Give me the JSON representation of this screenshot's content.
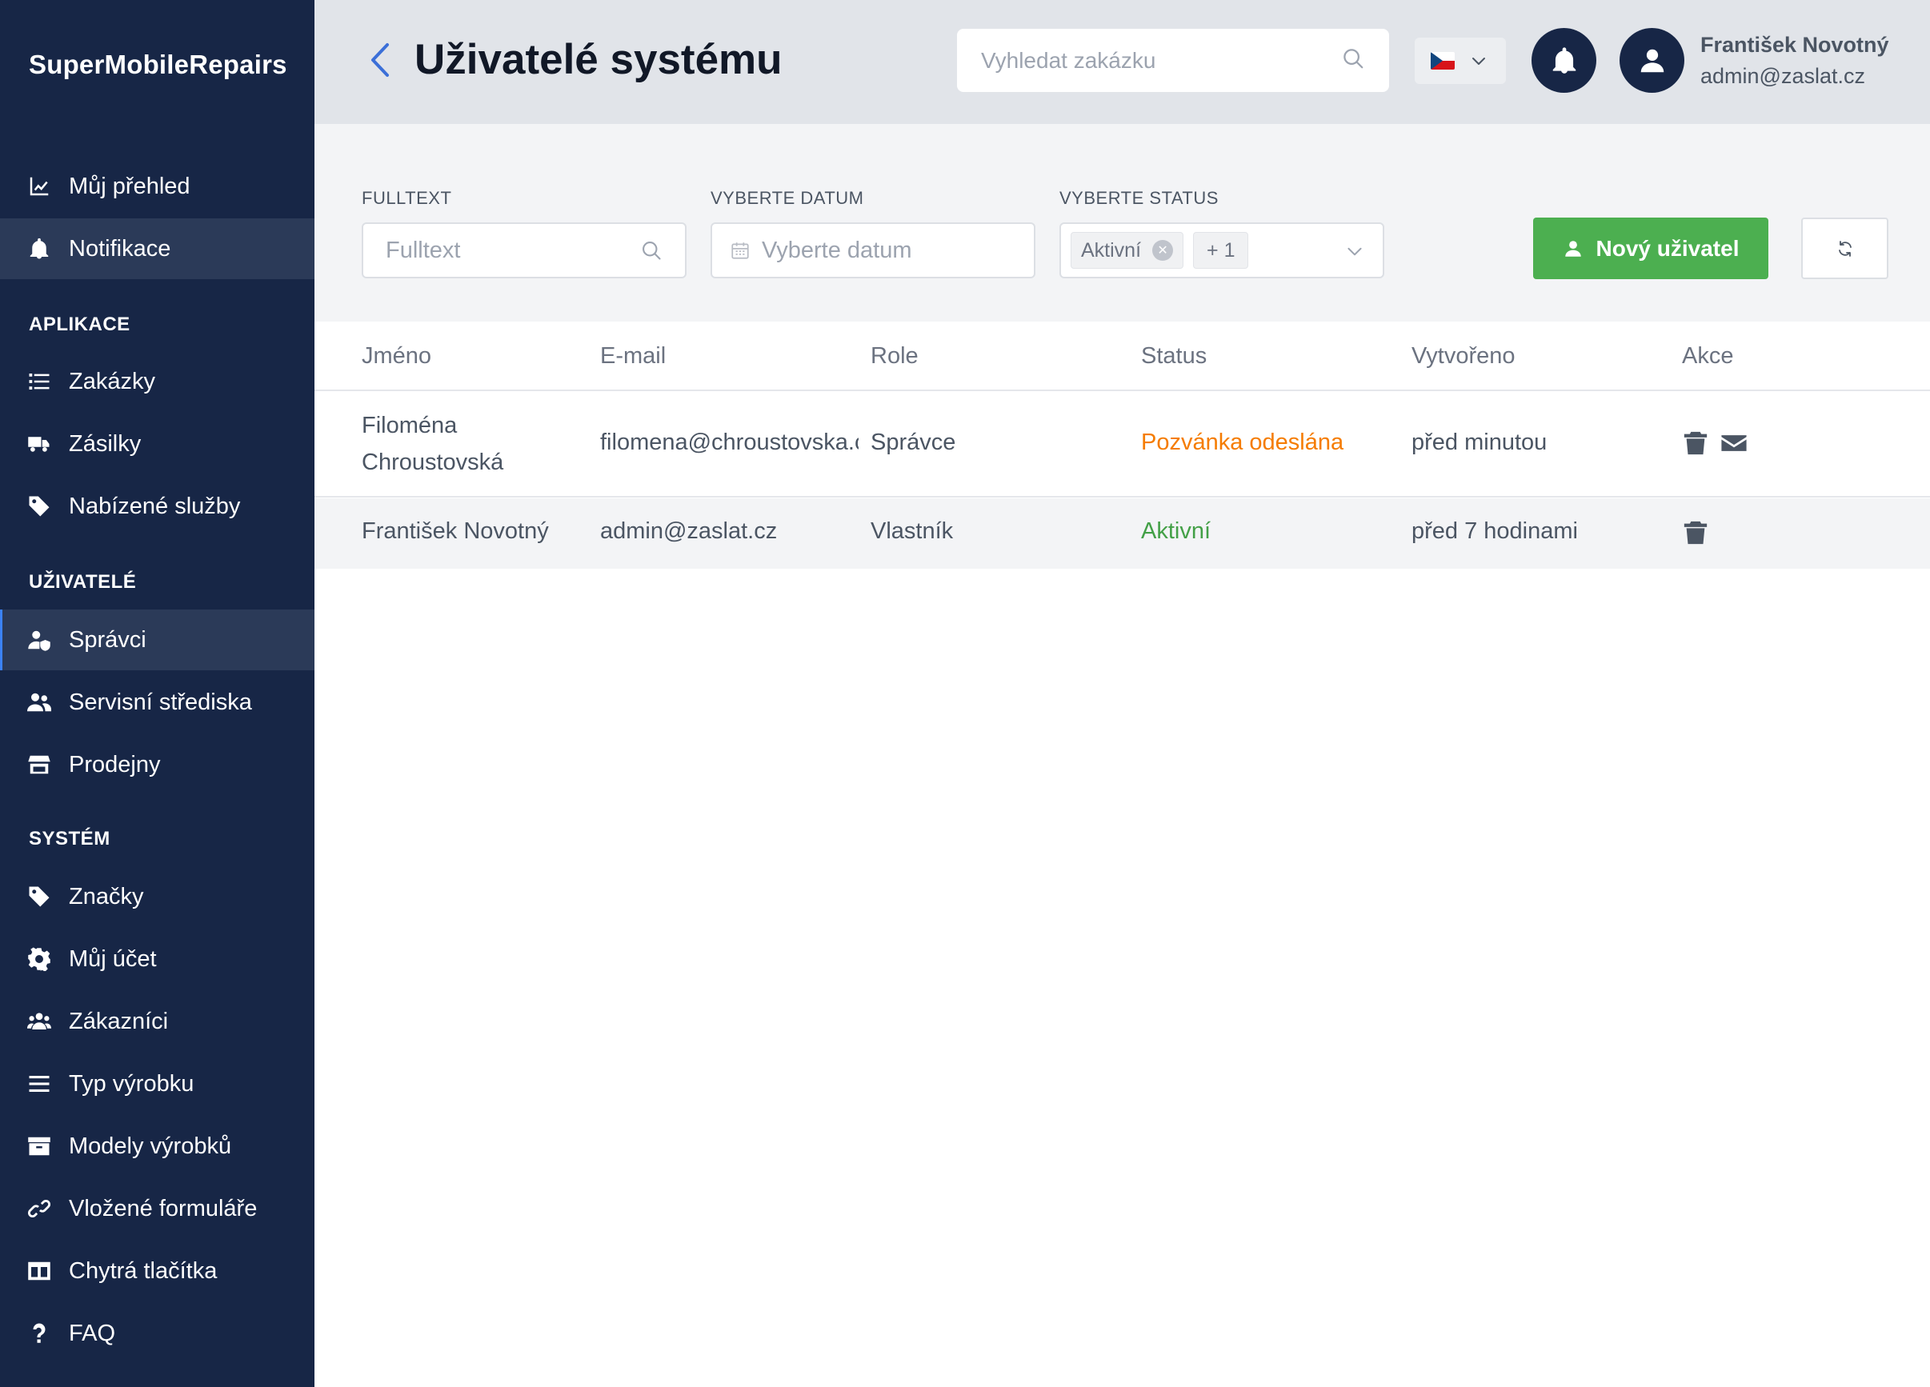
{
  "brand": "SuperMobileRepairs",
  "sidebar": {
    "top_items": [
      {
        "label": "Můj přehled",
        "icon": "chart-line-icon"
      },
      {
        "label": "Notifikace",
        "icon": "bell-icon"
      }
    ],
    "sections": [
      {
        "title": "APLIKACE",
        "items": [
          {
            "label": "Zakázky",
            "icon": "list-icon"
          },
          {
            "label": "Zásilky",
            "icon": "truck-icon"
          },
          {
            "label": "Nabízené služby",
            "icon": "tag-icon"
          }
        ]
      },
      {
        "title": "UŽIVATELÉ",
        "items": [
          {
            "label": "Správci",
            "icon": "user-shield-icon"
          },
          {
            "label": "Servisní střediska",
            "icon": "users-icon"
          },
          {
            "label": "Prodejny",
            "icon": "store-icon"
          }
        ]
      },
      {
        "title": "SYSTÉM",
        "items": [
          {
            "label": "Značky",
            "icon": "tag-icon"
          },
          {
            "label": "Můj účet",
            "icon": "gear-icon"
          },
          {
            "label": "Zákazníci",
            "icon": "users-group-icon"
          },
          {
            "label": "Typ výrobku",
            "icon": "bars-icon"
          },
          {
            "label": "Modely výrobků",
            "icon": "archive-icon"
          },
          {
            "label": "Vložené formuláře",
            "icon": "link-icon"
          },
          {
            "label": "Chytrá tlačítka",
            "icon": "columns-icon"
          },
          {
            "label": "FAQ",
            "icon": "question-icon"
          }
        ]
      }
    ],
    "active_item": "Správci"
  },
  "header": {
    "title": "Uživatelé systému",
    "search_placeholder": "Vyhledat zakázku",
    "language": "cs",
    "user_name": "František Novotný",
    "user_email": "admin@zaslat.cz"
  },
  "filters": {
    "fulltext_label": "FULLTEXT",
    "fulltext_placeholder": "Fulltext",
    "date_label": "VYBERTE DATUM",
    "date_placeholder": "Vyberte datum",
    "status_label": "VYBERTE STATUS",
    "status_tag": "Aktivní",
    "status_more": "+ 1",
    "new_user_label": "Nový uživatel"
  },
  "table": {
    "columns": [
      "Jméno",
      "E-mail",
      "Role",
      "Status",
      "Vytvořeno",
      "Akce"
    ],
    "rows": [
      {
        "name_line1": "Filoména",
        "name_line2": "Chroustovská",
        "email": "filomena@chroustovska.cz",
        "role": "Správce",
        "status": "Pozvánka odeslána",
        "created": "před minutou"
      },
      {
        "name_line1": "František Novotný",
        "name_line2": "",
        "email": "admin@zaslat.cz",
        "role": "Vlastník",
        "status": "Aktivní",
        "created": "před 7 hodinami"
      }
    ]
  },
  "colors": {
    "sidebar_bg": "#172646",
    "accent_green": "#4caf50",
    "status_invited": "#f57c00",
    "status_active": "#43a047"
  }
}
